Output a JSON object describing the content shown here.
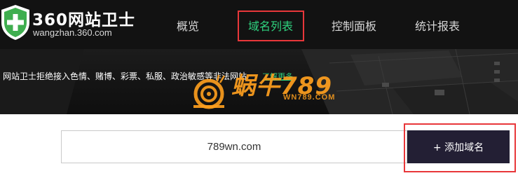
{
  "header": {
    "brand_name": "360网站卫士",
    "brand_domain": "wangzhan.360.com",
    "nav": [
      {
        "label": "概览",
        "active": false
      },
      {
        "label": "域名列表",
        "active": true
      },
      {
        "label": "控制面板",
        "active": false
      },
      {
        "label": "统计报表",
        "active": false
      }
    ]
  },
  "banner": {
    "notice": "网站卫士拒绝接入色情、赌博、彩票、私服、政治敏感等非法网站",
    "learn_more": "了解更多"
  },
  "watermark": {
    "text": "蜗牛789",
    "url": "WN789.COM",
    "icon": "snail-icon"
  },
  "form": {
    "domain_value": "789wn.com",
    "add_button_label": "+ 添加域名"
  },
  "colors": {
    "header_bg": "#121212",
    "active_nav": "#2fd37f",
    "button_bg": "#231f34",
    "highlight_box": "#e8373a",
    "watermark": "#ffa01e"
  }
}
